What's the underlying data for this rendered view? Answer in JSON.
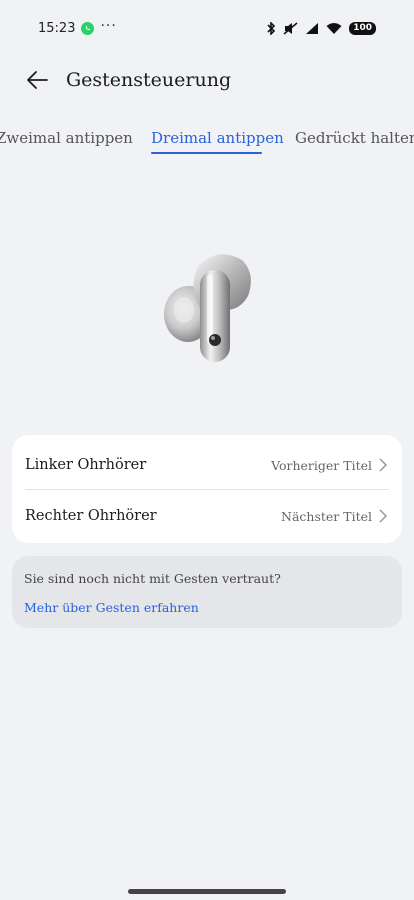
{
  "status_bar": {
    "time": "15:23",
    "battery": "100"
  },
  "header": {
    "title": "Gestensteuerung"
  },
  "tabs": [
    {
      "label": "Zweimal antippen",
      "active": false
    },
    {
      "label": "Dreimal antippen",
      "active": true
    },
    {
      "label": "Gedrückt halten",
      "active": false
    }
  ],
  "options": [
    {
      "label": "Linker Ohrhörer",
      "value": "Vorheriger Titel"
    },
    {
      "label": "Rechter Ohrhörer",
      "value": "Nächster Titel"
    }
  ],
  "help": {
    "question": "Sie sind noch nicht mit Gesten vertraut?",
    "link": "Mehr über Gesten erfahren"
  },
  "colors": {
    "accent": "#2962d9",
    "background": "#f1f2f6"
  }
}
